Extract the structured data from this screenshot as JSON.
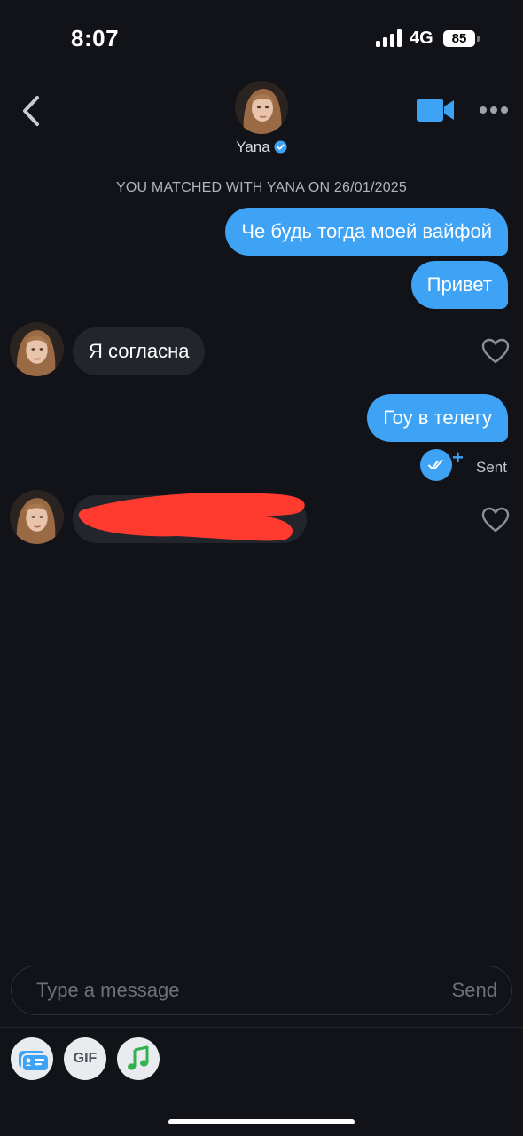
{
  "status_bar": {
    "time": "8:07",
    "network": "4G",
    "battery": "85"
  },
  "header": {
    "name": "Yana",
    "verified": true,
    "icons": [
      "back-chevron-icon",
      "video-call-icon",
      "more-icon"
    ]
  },
  "match_notice": "YOU MATCHED WITH YANA ON 26/01/2025",
  "messages": [
    {
      "direction": "outgoing",
      "text": "Че будь тогда моей вайфой"
    },
    {
      "direction": "outgoing",
      "text": "Привет"
    },
    {
      "direction": "incoming",
      "text": "Я согласна"
    },
    {
      "direction": "outgoing",
      "text": "Гоу в телегу",
      "status": "Sent"
    },
    {
      "direction": "incoming",
      "text": "",
      "redacted": true
    }
  ],
  "composer": {
    "placeholder": "Type a message",
    "send_label": "Send"
  },
  "toolbar": {
    "gif_label": "GIF",
    "icons": [
      "contact-card-icon",
      "gif-icon",
      "music-note-icon"
    ]
  },
  "colors": {
    "background": "#111319",
    "outgoing_bubble": "#3ea2f5",
    "incoming_bubble": "#22252c",
    "accent": "#3ea2f5",
    "redaction": "#ff3b30"
  }
}
